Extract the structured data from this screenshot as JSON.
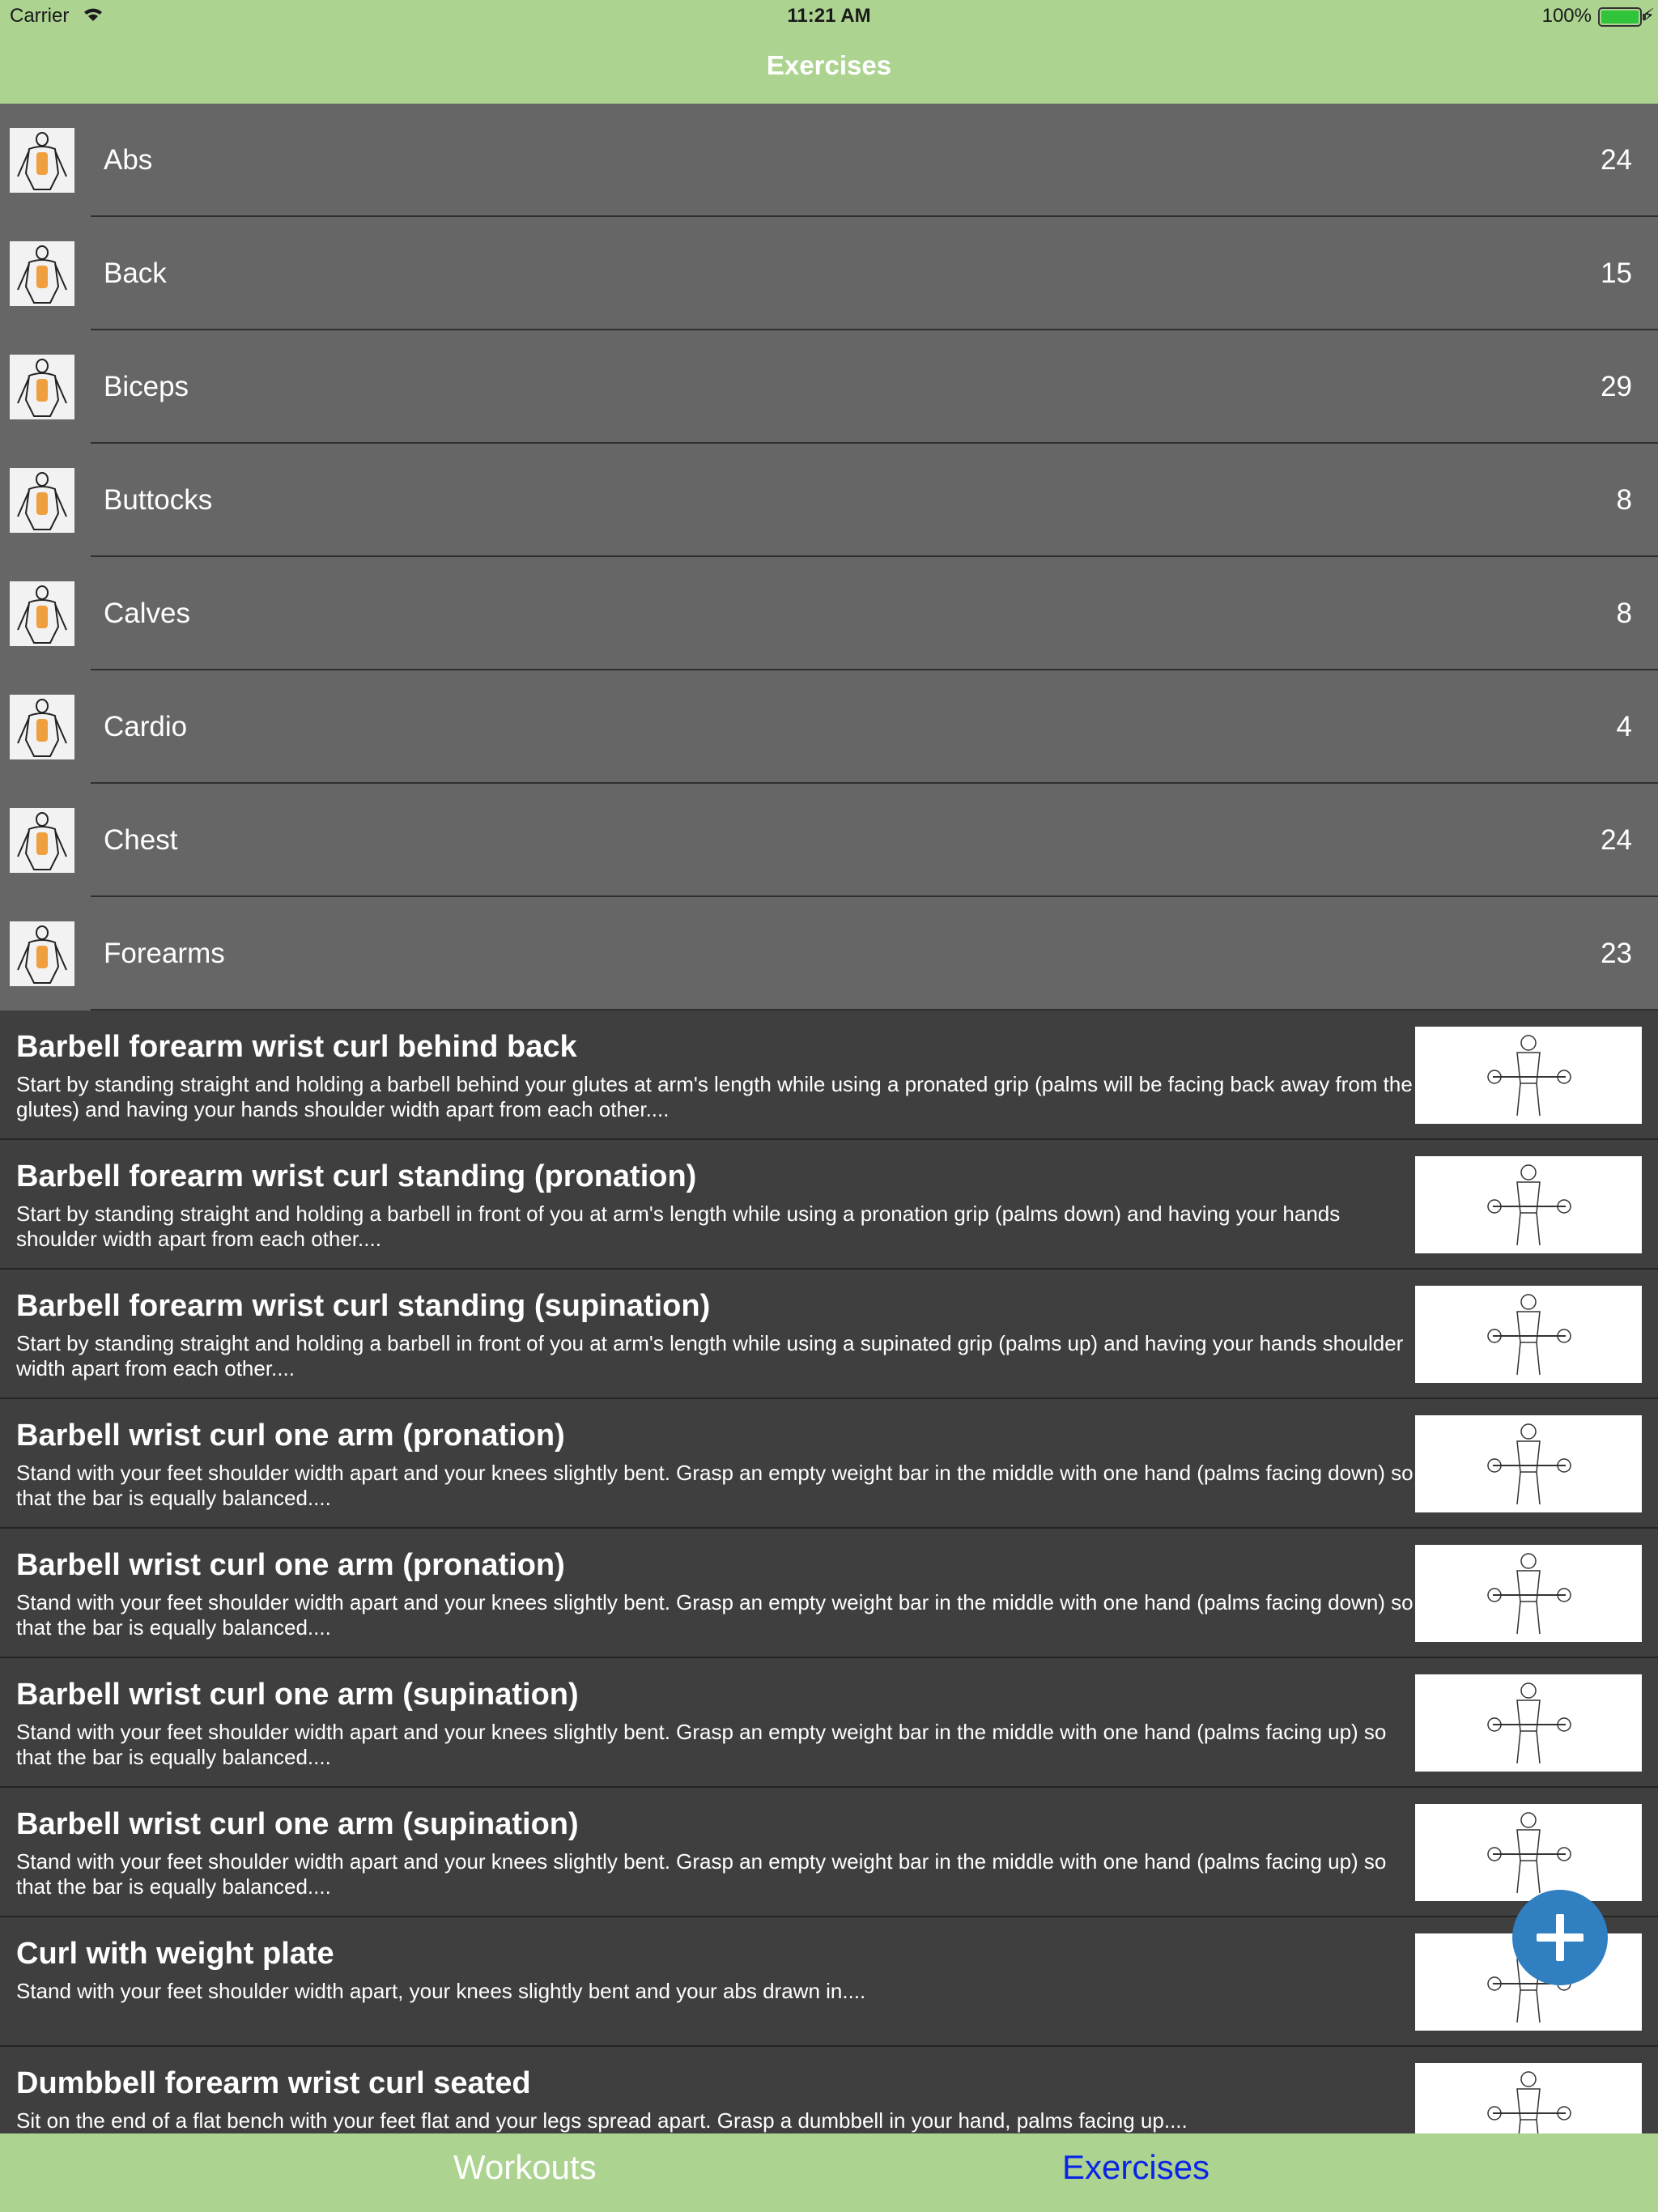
{
  "status_bar": {
    "carrier": "Carrier",
    "time": "11:21 AM",
    "battery": "100%"
  },
  "nav": {
    "title": "Exercises"
  },
  "categories": [
    {
      "label": "Abs",
      "count": "24",
      "icon": "abs-icon"
    },
    {
      "label": "Back",
      "count": "15",
      "icon": "back-icon"
    },
    {
      "label": "Biceps",
      "count": "29",
      "icon": "biceps-icon"
    },
    {
      "label": "Buttocks",
      "count": "8",
      "icon": "buttocks-icon"
    },
    {
      "label": "Calves",
      "count": "8",
      "icon": "calves-icon"
    },
    {
      "label": "Cardio",
      "count": "4",
      "icon": "cardio-icon"
    },
    {
      "label": "Chest",
      "count": "24",
      "icon": "chest-icon"
    },
    {
      "label": "Forearms",
      "count": "23",
      "icon": "forearms-icon"
    }
  ],
  "exercises": [
    {
      "title": "Barbell forearm wrist curl behind back",
      "desc": "Start by standing straight and holding a barbell behind your glutes at arm's length while using a pronated grip (palms will be facing back away from the glutes) and having your hands shoulder width apart from each other...."
    },
    {
      "title": "Barbell forearm wrist curl standing (pronation)",
      "desc": "Start by standing straight and holding a barbell in front of you at arm's length while using a pronation grip (palms down) and having your hands shoulder width apart from each other...."
    },
    {
      "title": "Barbell forearm wrist curl standing (supination)",
      "desc": "Start by standing straight and holding a barbell in front of you at arm's length while using a supinated grip (palms up) and having your hands shoulder width apart from each other...."
    },
    {
      "title": "Barbell wrist curl one arm (pronation)",
      "desc": "Stand with your feet shoulder width apart and your knees slightly bent. Grasp an empty weight bar in the middle with one hand (palms facing down) so that the bar is equally balanced...."
    },
    {
      "title": "Barbell wrist curl one arm (pronation)",
      "desc": "Stand with your feet shoulder width apart and your knees slightly bent. Grasp an empty weight bar in the middle with one hand (palms facing down) so that the bar is equally balanced...."
    },
    {
      "title": "Barbell wrist curl one arm (supination)",
      "desc": "Stand with your feet shoulder width apart and your knees slightly bent. Grasp an empty weight bar in the middle with one hand (palms facing up) so that the bar is equally balanced...."
    },
    {
      "title": "Barbell wrist curl one arm (supination)",
      "desc": "Stand with your feet shoulder width apart and your knees slightly bent. Grasp an empty weight bar in the middle with one hand (palms facing up) so that the bar is equally balanced...."
    },
    {
      "title": "Curl with weight plate",
      "desc": "Stand with your feet shoulder width apart, your knees slightly bent and your abs drawn in...."
    },
    {
      "title": "Dumbbell forearm wrist curl seated",
      "desc": "Sit on the end of a flat bench with your feet flat and your legs spread apart. Grasp a dumbbell in your hand, palms facing up...."
    }
  ],
  "fab": {
    "icon": "plus-icon"
  },
  "tabbar": {
    "workouts": "Workouts",
    "exercises": "Exercises"
  },
  "colors": {
    "bar_green": "#add391",
    "category_bg": "#666666",
    "exercise_bg": "#3f3f3f",
    "fab_blue": "#2f7fc1",
    "active_tab": "#0a24e6"
  }
}
